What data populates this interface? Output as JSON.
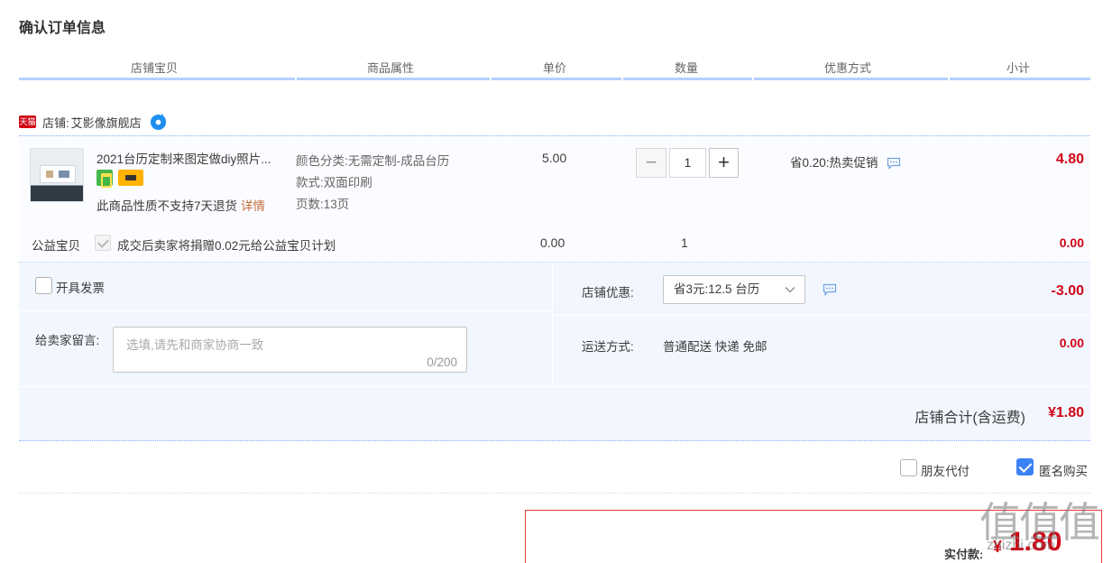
{
  "page_title": "确认订单信息",
  "columns": [
    "店铺宝贝",
    "商品属性",
    "单价",
    "数量",
    "优惠方式",
    "小计"
  ],
  "shop": {
    "badge": "天猫",
    "label": "店铺:",
    "name": "艾影像旗舰店"
  },
  "item": {
    "title": "2021台历定制来图定做diy照片...",
    "no_return": "此商品性质不支持7天退货",
    "detail_link": "详情",
    "attrs": [
      "颜色分类:无需定制-成品台历",
      "款式:双面印刷",
      "页数:13页"
    ],
    "unit_price": "5.00",
    "quantity": "1",
    "qty_minus": "−",
    "qty_plus": "+",
    "promo": "省0.20:热卖促销",
    "subtotal": "4.80"
  },
  "charity": {
    "label": "公益宝贝",
    "text": "成交后卖家将捐赠0.02元给公益宝贝计划",
    "price": "0.00",
    "quantity": "1",
    "subtotal": "0.00"
  },
  "invoice": {
    "label": "开具发票",
    "checked": false
  },
  "memo": {
    "label": "给卖家留言:",
    "placeholder": "选填,请先和商家协商一致",
    "count": "0/200"
  },
  "shop_discount": {
    "label": "店铺优惠:",
    "selected": "省3元:12.5 台历",
    "amount": "-3.00"
  },
  "shipping": {
    "label": "运送方式:",
    "value": "普通配送 快递 免邮",
    "amount": "0.00"
  },
  "shop_total": {
    "label": "店铺合计(含运费)",
    "amount": "¥1.80"
  },
  "options": {
    "friend_pay": "朋友代付",
    "anonymous": "匿名购买",
    "anonymous_checked": true
  },
  "payment": {
    "label": "实付款:",
    "currency": "¥",
    "amount": "1.80"
  },
  "watermark": {
    "text": "值值值",
    "url": "zhizhi.com"
  },
  "colors": {
    "price_red": "#d10416",
    "header_line": "#b2d1ff",
    "panel_bg": "#f2f7ff",
    "check_blue": "#3b82f6"
  }
}
